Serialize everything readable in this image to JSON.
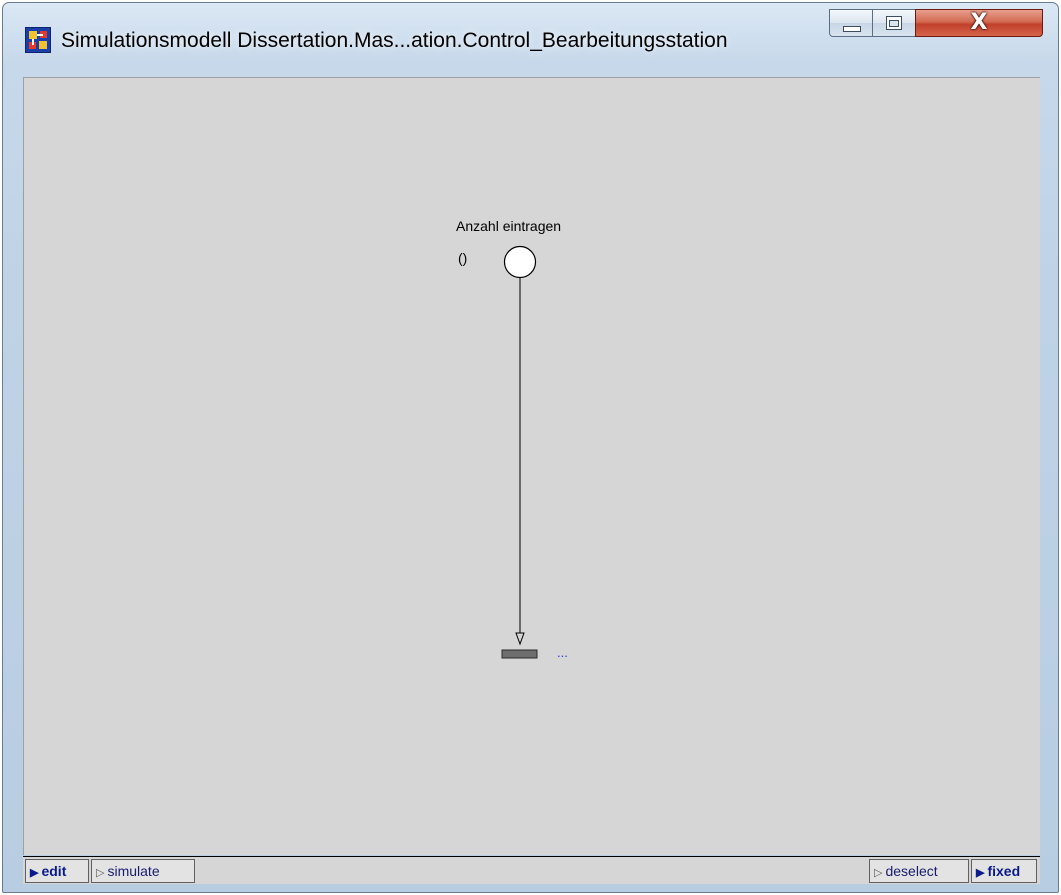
{
  "window": {
    "title": "Simulationsmodell Dissertation.Mas...ation.Control_Bearbeitungsstation",
    "icon": "petri-net-app-icon",
    "controls": {
      "minimize_icon": "minimize-icon",
      "maximize_icon": "maximize-icon",
      "close_glyph": "X"
    }
  },
  "canvas": {
    "background": "#d6d6d6",
    "node": {
      "label": "Anzahl eintragen",
      "marking": "()",
      "annotation": "..."
    }
  },
  "statusbar": {
    "edit_label": "edit",
    "simulate_label": "simulate",
    "deselect_label": "deselect",
    "fixed_label": "fixed",
    "arrow_filled": "▶",
    "arrow_hollow": "▷"
  },
  "colors": {
    "accent": "#0a1a8c",
    "annotation": "#2a3bd6",
    "close_button": "#c0402a"
  }
}
